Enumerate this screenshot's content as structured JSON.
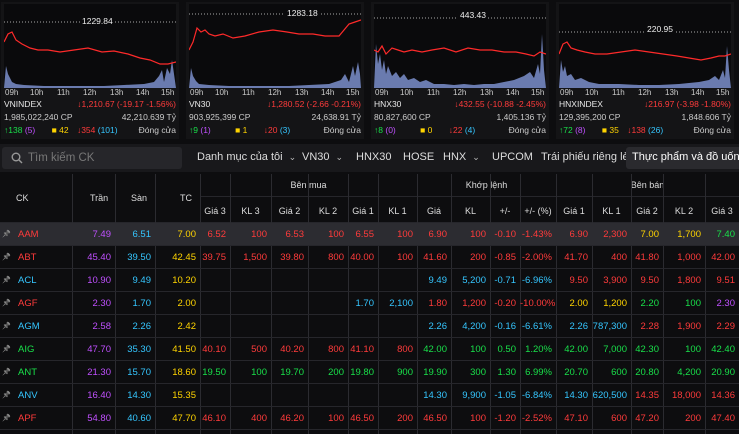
{
  "colors": {
    "red": "#ff3b3b",
    "green": "#19e04a",
    "yellow": "#ffd400",
    "purple": "#c050ff",
    "cyan": "#35c6ff"
  },
  "indices": [
    {
      "name": "VNINDEX",
      "max": "1229.84",
      "change": "↓1,210.67 (-19.17 -1.56%)",
      "volume": "1,985,022,240 CP",
      "value": "42,210.639 Tỷ",
      "up": "↑138",
      "up_ceil": "(5)",
      "flat": "42",
      "down": "↓354",
      "down_floor": "(101)",
      "status": "Đóng cửa",
      "times": [
        "09h",
        "10h",
        "11h",
        "12h",
        "13h",
        "14h",
        "15h"
      ]
    },
    {
      "name": "VN30",
      "max": "1283.18",
      "change": "↓1,280.52 (-2.66 -0.21%)",
      "volume": "903,925,399 CP",
      "value": "24,638.91 Tỷ",
      "up": "↑9",
      "up_ceil": "(1)",
      "flat": "1",
      "down": "↓20",
      "down_floor": "(3)",
      "status": "Đóng cửa",
      "times": [
        "09h",
        "10h",
        "11h",
        "12h",
        "13h",
        "14h",
        "15h"
      ]
    },
    {
      "name": "HNX30",
      "max": "443.43",
      "change": "↓432.55 (-10.88 -2.45%)",
      "volume": "80,827,600 CP",
      "value": "1,405.136 Tỷ",
      "up": "↑8",
      "up_ceil": "(0)",
      "flat": "0",
      "down": "↓22",
      "down_floor": "(4)",
      "status": "Đóng cửa",
      "times": [
        "09h",
        "10h",
        "11h",
        "12h",
        "13h",
        "14h",
        "15h"
      ]
    },
    {
      "name": "HNXINDEX",
      "max": "220.95",
      "change": "↓216.97 (-3.98 -1.80%)",
      "volume": "129,395,200 CP",
      "value": "1,848.606 Tỷ",
      "up": "↑72",
      "up_ceil": "(8)",
      "flat": "35",
      "down": "↓138",
      "down_floor": "(26)",
      "status": "Đóng cửa",
      "times": [
        "09h",
        "10h",
        "11h",
        "12h",
        "13h",
        "14h",
        "15h"
      ]
    }
  ],
  "toolbar": {
    "search_placeholder": "Tìm kiếm CK",
    "tabs": [
      "Danh mục của tôi",
      "VN30",
      "HNX30",
      "HOSE",
      "HNX",
      "UPCOM",
      "Trái phiếu riêng lẻ",
      "Thực phẩm và đồ uống"
    ]
  },
  "table": {
    "headers": {
      "ck": "CK",
      "tran": "Trần",
      "san": "Sàn",
      "tc": "TC",
      "ben_mua": "Bên mua",
      "khop_lenh": "Khớp lệnh",
      "ben_ban": "Bên bán",
      "sub": [
        "Giá 3",
        "KL 3",
        "Giá 2",
        "KL 2",
        "Giá 1",
        "KL 1",
        "Giá",
        "KL",
        "+/-",
        "+/- (%)",
        "Giá 1",
        "KL 1",
        "Giá 2",
        "KL 2",
        "Giá 3"
      ]
    },
    "rows": [
      {
        "ck": "AAM",
        "ckc": "red",
        "tran": "7.49",
        "san": "6.51",
        "tc": "7.00",
        "vals": [
          [
            "6.52",
            "red"
          ],
          [
            "100",
            "red"
          ],
          [
            "6.53",
            "red"
          ],
          [
            "100",
            "red"
          ],
          [
            "6.55",
            "red"
          ],
          [
            "100",
            "red"
          ],
          [
            "6.90",
            "red"
          ],
          [
            "100",
            "red"
          ],
          [
            "-0.10",
            "red"
          ],
          [
            "-1.43%",
            "red"
          ],
          [
            "6.90",
            "red"
          ],
          [
            "2,300",
            "red"
          ],
          [
            "7.00",
            "yellow"
          ],
          [
            "1,700",
            "yellow"
          ],
          [
            "7.40",
            "green"
          ]
        ]
      },
      {
        "ck": "ABT",
        "ckc": "red",
        "tran": "45.40",
        "san": "39.50",
        "tc": "42.45",
        "vals": [
          [
            "39.75",
            "red"
          ],
          [
            "1,500",
            "red"
          ],
          [
            "39.80",
            "red"
          ],
          [
            "800",
            "red"
          ],
          [
            "40.00",
            "red"
          ],
          [
            "100",
            "red"
          ],
          [
            "41.60",
            "red"
          ],
          [
            "200",
            "red"
          ],
          [
            "-0.85",
            "red"
          ],
          [
            "-2.00%",
            "red"
          ],
          [
            "41.70",
            "red"
          ],
          [
            "400",
            "red"
          ],
          [
            "41.80",
            "red"
          ],
          [
            "1,000",
            "red"
          ],
          [
            "42.00",
            "red"
          ]
        ]
      },
      {
        "ck": "ACL",
        "ckc": "cyan",
        "tran": "10.90",
        "san": "9.49",
        "tc": "10.20",
        "vals": [
          [
            "",
            ""
          ],
          [
            "",
            ""
          ],
          [
            "",
            ""
          ],
          [
            "",
            ""
          ],
          [
            "",
            ""
          ],
          [
            "",
            ""
          ],
          [
            "9.49",
            "cyan"
          ],
          [
            "5,200",
            "cyan"
          ],
          [
            "-0.71",
            "cyan"
          ],
          [
            "-6.96%",
            "cyan"
          ],
          [
            "9.50",
            "red"
          ],
          [
            "3,900",
            "red"
          ],
          [
            "9.50",
            "red"
          ],
          [
            "1,800",
            "red"
          ],
          [
            "9.51",
            "red"
          ]
        ]
      },
      {
        "ck": "AGF",
        "ckc": "red",
        "tran": "2.30",
        "san": "1.70",
        "tc": "2.00",
        "vals": [
          [
            "",
            ""
          ],
          [
            "",
            ""
          ],
          [
            "",
            ""
          ],
          [
            "",
            ""
          ],
          [
            "1.70",
            "cyan"
          ],
          [
            "2,100",
            "cyan"
          ],
          [
            "1.80",
            "red"
          ],
          [
            "1,200",
            "red"
          ],
          [
            "-0.20",
            "red"
          ],
          [
            "-10.00%",
            "red"
          ],
          [
            "2.00",
            "yellow"
          ],
          [
            "1,200",
            "yellow"
          ],
          [
            "2.20",
            "green"
          ],
          [
            "100",
            "green"
          ],
          [
            "2.30",
            "purple"
          ]
        ]
      },
      {
        "ck": "AGM",
        "ckc": "cyan",
        "tran": "2.58",
        "san": "2.26",
        "tc": "2.42",
        "vals": [
          [
            "",
            ""
          ],
          [
            "",
            ""
          ],
          [
            "",
            ""
          ],
          [
            "",
            ""
          ],
          [
            "",
            ""
          ],
          [
            "",
            ""
          ],
          [
            "2.26",
            "cyan"
          ],
          [
            "4,200",
            "cyan"
          ],
          [
            "-0.16",
            "cyan"
          ],
          [
            "-6.61%",
            "cyan"
          ],
          [
            "2.26",
            "cyan"
          ],
          [
            "787,300",
            "cyan"
          ],
          [
            "2.28",
            "red"
          ],
          [
            "1,900",
            "red"
          ],
          [
            "2.29",
            "red"
          ]
        ]
      },
      {
        "ck": "AIG",
        "ckc": "green",
        "tran": "47.70",
        "san": "35.30",
        "tc": "41.50",
        "vals": [
          [
            "40.10",
            "red"
          ],
          [
            "500",
            "red"
          ],
          [
            "40.20",
            "red"
          ],
          [
            "800",
            "red"
          ],
          [
            "41.10",
            "red"
          ],
          [
            "800",
            "red"
          ],
          [
            "42.00",
            "green"
          ],
          [
            "100",
            "green"
          ],
          [
            "0.50",
            "green"
          ],
          [
            "1.20%",
            "green"
          ],
          [
            "42.00",
            "green"
          ],
          [
            "7,000",
            "green"
          ],
          [
            "42.30",
            "green"
          ],
          [
            "100",
            "green"
          ],
          [
            "42.40",
            "green"
          ]
        ]
      },
      {
        "ck": "ANT",
        "ckc": "green",
        "tran": "21.30",
        "san": "15.70",
        "tc": "18.60",
        "vals": [
          [
            "19.50",
            "green"
          ],
          [
            "100",
            "green"
          ],
          [
            "19.70",
            "green"
          ],
          [
            "200",
            "green"
          ],
          [
            "19.80",
            "green"
          ],
          [
            "900",
            "green"
          ],
          [
            "19.90",
            "green"
          ],
          [
            "300",
            "green"
          ],
          [
            "1.30",
            "green"
          ],
          [
            "6.99%",
            "green"
          ],
          [
            "20.70",
            "green"
          ],
          [
            "600",
            "green"
          ],
          [
            "20.80",
            "green"
          ],
          [
            "4,200",
            "green"
          ],
          [
            "20.90",
            "green"
          ]
        ]
      },
      {
        "ck": "ANV",
        "ckc": "cyan",
        "tran": "16.40",
        "san": "14.30",
        "tc": "15.35",
        "vals": [
          [
            "",
            ""
          ],
          [
            "",
            ""
          ],
          [
            "",
            ""
          ],
          [
            "",
            ""
          ],
          [
            "",
            ""
          ],
          [
            "",
            ""
          ],
          [
            "14.30",
            "cyan"
          ],
          [
            "9,900",
            "cyan"
          ],
          [
            "-1.05",
            "cyan"
          ],
          [
            "-6.84%",
            "cyan"
          ],
          [
            "14.30",
            "cyan"
          ],
          [
            "620,500",
            "cyan"
          ],
          [
            "14.35",
            "red"
          ],
          [
            "18,000",
            "red"
          ],
          [
            "14.36",
            "red"
          ]
        ]
      },
      {
        "ck": "APF",
        "ckc": "red",
        "tran": "54.80",
        "san": "40.60",
        "tc": "47.70",
        "vals": [
          [
            "46.10",
            "red"
          ],
          [
            "400",
            "red"
          ],
          [
            "46.20",
            "red"
          ],
          [
            "100",
            "red"
          ],
          [
            "46.50",
            "red"
          ],
          [
            "200",
            "red"
          ],
          [
            "46.50",
            "red"
          ],
          [
            "100",
            "red"
          ],
          [
            "-1.20",
            "red"
          ],
          [
            "-2.52%",
            "red"
          ],
          [
            "47.10",
            "red"
          ],
          [
            "600",
            "red"
          ],
          [
            "47.20",
            "red"
          ],
          [
            "200",
            "red"
          ],
          [
            "47.40",
            "red"
          ]
        ]
      }
    ]
  }
}
